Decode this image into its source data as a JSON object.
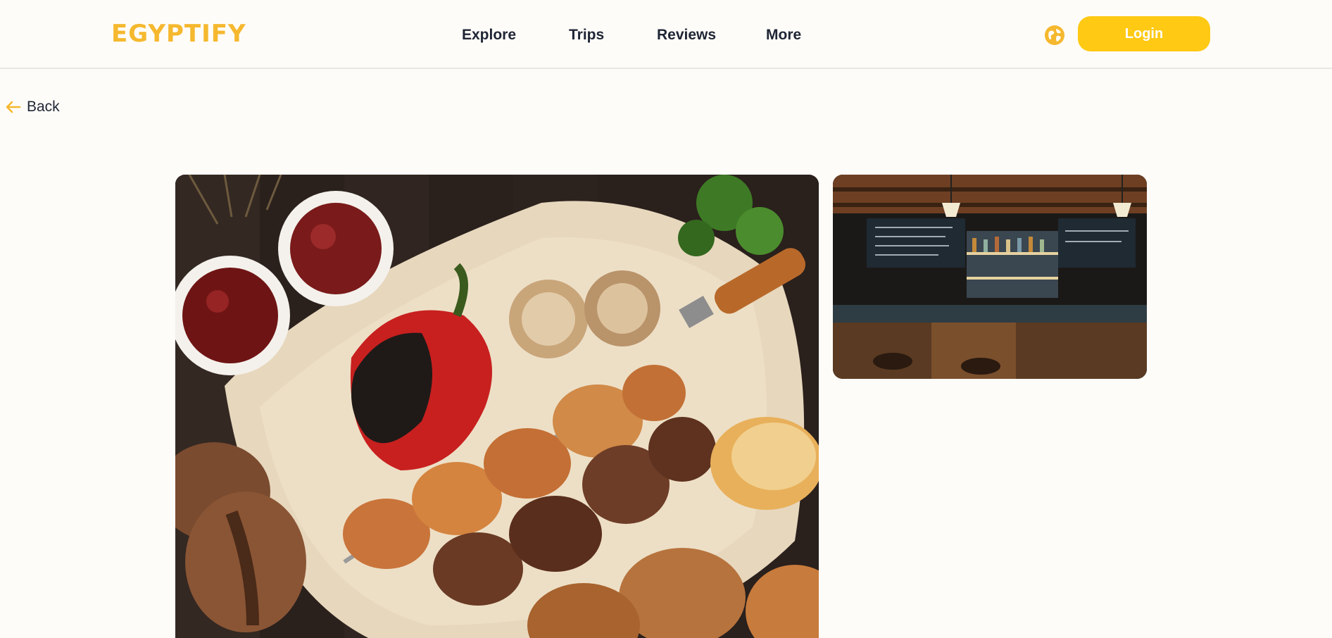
{
  "header": {
    "logo_text": "EGYPTIFY",
    "nav": [
      {
        "label": "Explore"
      },
      {
        "label": "Trips"
      },
      {
        "label": "Reviews"
      },
      {
        "label": "More"
      }
    ],
    "language_icon": "globe-icon",
    "login_label": "Login"
  },
  "back": {
    "label": "Back",
    "icon": "arrow-left-icon"
  },
  "gallery": {
    "main_image": "grilled-kebab-platter-photo",
    "side_image": "restaurant-bar-interior-photo"
  },
  "colors": {
    "accent": "#ffc914",
    "logo": "#f5b82e",
    "text": "#1e2535",
    "background": "#fefcf8"
  }
}
